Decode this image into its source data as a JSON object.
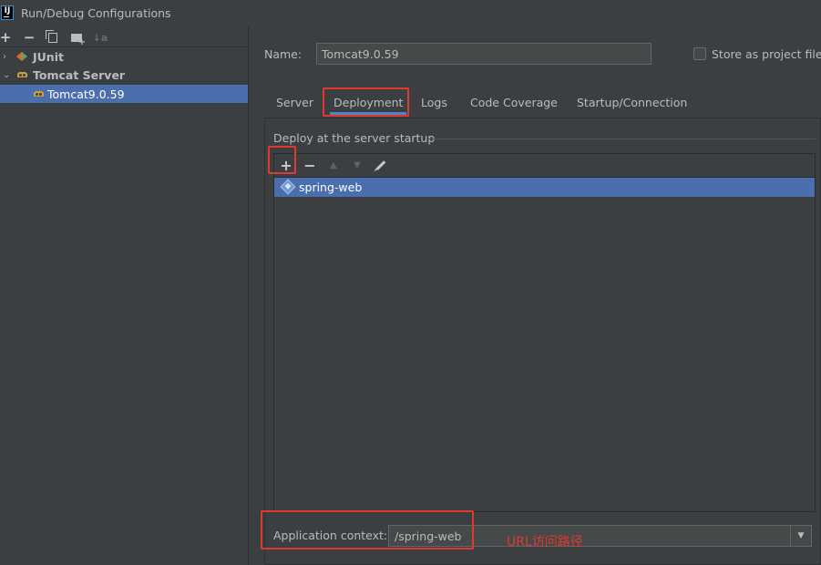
{
  "window": {
    "title": "Run/Debug Configurations",
    "app_icon_text": "IJ"
  },
  "left_toolbar": {
    "add": "+",
    "remove": "−",
    "sort": "↓a"
  },
  "tree": {
    "items": [
      {
        "label": "JUnit",
        "expanded": false,
        "icon": "junit-icon"
      },
      {
        "label": "Tomcat Server",
        "expanded": true,
        "icon": "tomcat-icon"
      },
      {
        "label": "Tomcat9.0.59",
        "selected": true,
        "icon": "tomcat-icon"
      }
    ],
    "chevron_collapsed": "›",
    "chevron_expanded": "⌄"
  },
  "form": {
    "name_label": "Name:",
    "name_value": "Tomcat9.0.59",
    "store_label": "Store as project file",
    "store_checked": false
  },
  "tabs": [
    {
      "label": "Server"
    },
    {
      "label": "Deployment",
      "active": true
    },
    {
      "label": "Logs"
    },
    {
      "label": "Code Coverage"
    },
    {
      "label": "Startup/Connection"
    }
  ],
  "deployment": {
    "group_title": "Deploy at the server startup",
    "toolbar": {
      "add": "+",
      "remove": "−",
      "up": "▲",
      "down": "▼"
    },
    "artifacts": [
      {
        "label": "spring-web",
        "selected": true,
        "icon": "artifact-icon"
      }
    ],
    "context_label": "Application context:",
    "context_value": "/spring-web",
    "dropdown_arrow": "▼"
  },
  "annotation": {
    "text": "URL访问路径",
    "color": "#e03a2f"
  },
  "colors": {
    "background": "#3c3f41",
    "selection": "#4b6eaf",
    "tab_underline": "#4a88c7",
    "highlight_box": "#e03a2f"
  },
  "icons": [
    "app-icon",
    "plus-icon",
    "minus-icon",
    "copy-icon",
    "new-folder-icon",
    "sort-icon",
    "junit-icon",
    "tomcat-icon",
    "artifact-icon",
    "pencil-icon",
    "arrow-up-icon",
    "arrow-down-icon",
    "dropdown-arrow-icon"
  ]
}
